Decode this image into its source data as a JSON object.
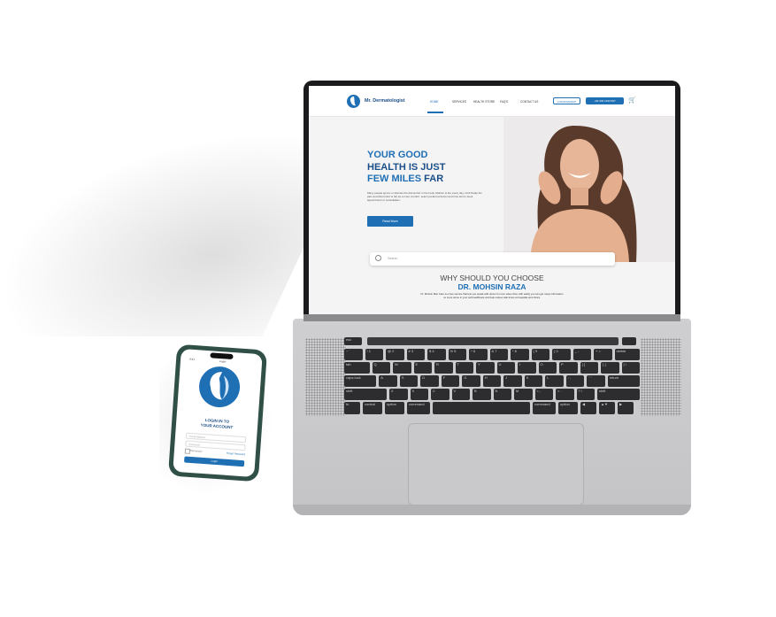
{
  "laptop_site": {
    "logo": "Mr. Dermatologist",
    "nav": [
      "HOME",
      "SERVICES",
      "HEALTH STORE",
      "FAQ'S",
      "CONTACT US"
    ],
    "login_label": "LOGIN/SIGNUP",
    "phone_label": "+92 300 1234 567",
    "headline": {
      "line1": "YOUR GOOD",
      "line2": "HEALTH IS JUST",
      "line3a": "FEW MILES ",
      "line3b": "FAR"
    },
    "hero_text": "Many people ignore or dismiss the discomfort in the body. Mohsin is the every day, Until finally the pain and discomfort is felt as a more comfort. select preferred doctor and time slot to book appointment or consultation.",
    "read_more": "Read More",
    "search_placeholder": "Search",
    "why_title": "WHY SHOULD YOU CHOOSE",
    "why_name": "DR. MOHSIN RAZA",
    "why_desc": "Dr. Mohsin Skin Care is a free service that lets you speak with doctor for over video chat. with easily you can get many information no more arrive in your self-healthcare and help reduce wait times at hospitals and clinics."
  },
  "phone_app": {
    "time": "9:41",
    "top_label": "Login",
    "title_line1": "LOGIN IN TO",
    "title_line2": "YOUR ACCOUNT",
    "email_placeholder": "Email Address",
    "password_placeholder": "Password",
    "remember": "Remember",
    "forgot": "Forgot Password",
    "button": "Login"
  },
  "colors": {
    "brand_blue": "#1f6fb5",
    "dark_blue": "#1b4f8a",
    "phone_frame": "#2f4f47"
  },
  "keyboard": {
    "rows": [
      [
        "esc"
      ],
      [
        "~ `",
        "! 1",
        "@ 2",
        "# 3",
        "$ 4",
        "% 5",
        "^ 6",
        "& 7",
        "* 8",
        "( 9",
        ") 0",
        "_ -",
        "+ =",
        "delete"
      ],
      [
        "tab",
        "Q",
        "W",
        "E",
        "R",
        "T",
        "Y",
        "U",
        "I",
        "O",
        "P",
        "{ [",
        "} ]",
        "| \\"
      ],
      [
        "caps lock",
        "A",
        "S",
        "D",
        "F",
        "G",
        "H",
        "J",
        "K",
        "L",
        ": ;",
        "\" '",
        "return"
      ],
      [
        "shift",
        "Z",
        "X",
        "C",
        "V",
        "B",
        "N",
        "M",
        "< ,",
        "> .",
        "? /",
        "shift"
      ],
      [
        "fn",
        "control",
        "option",
        "command",
        "",
        "command",
        "option",
        "◀",
        "▲▼",
        "▶"
      ]
    ]
  }
}
